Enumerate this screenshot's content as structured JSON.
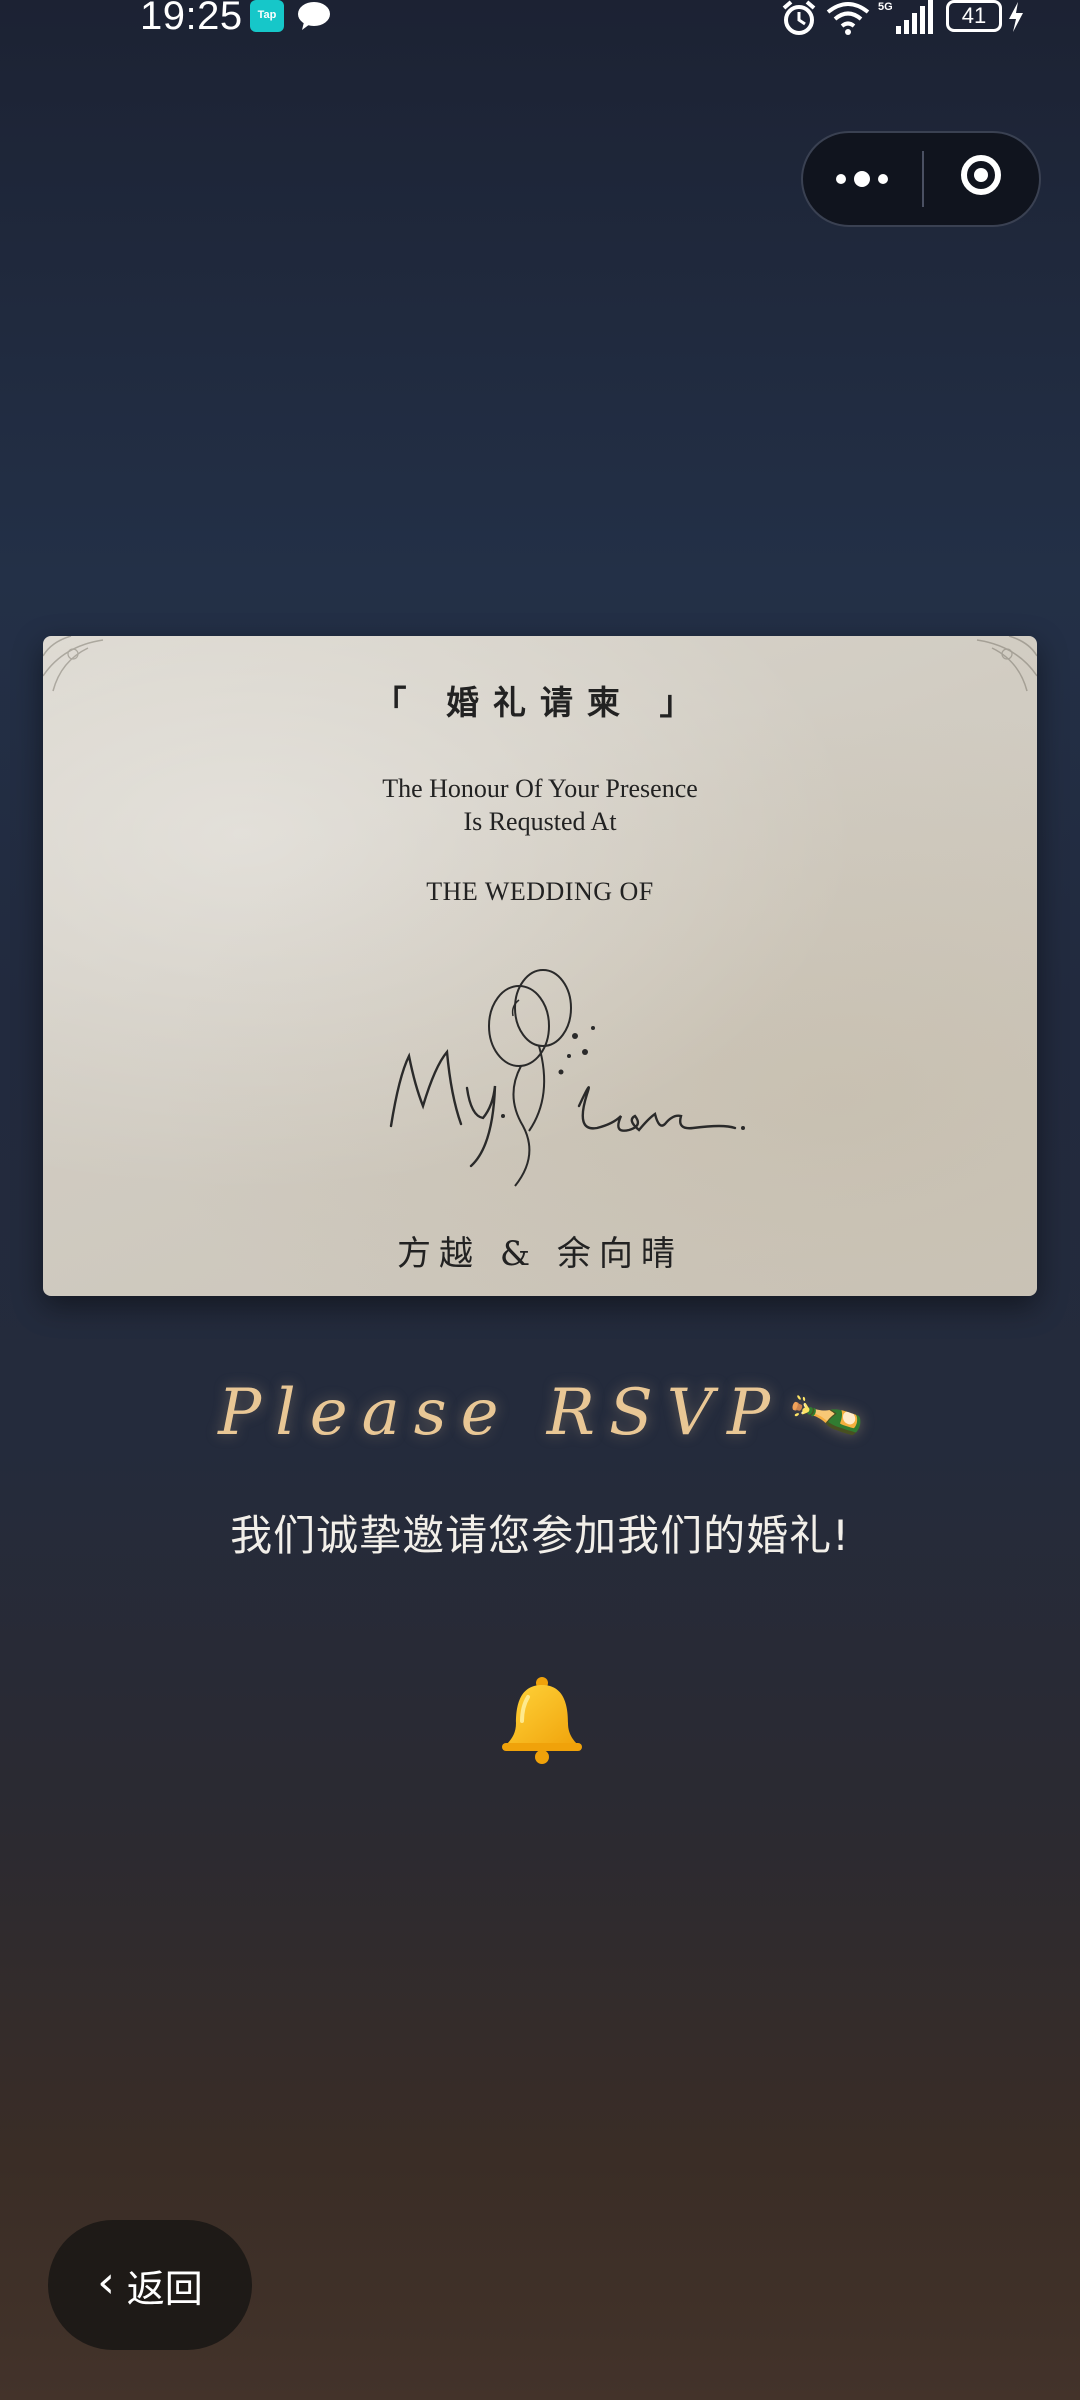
{
  "status_bar": {
    "time": "19:25",
    "app_badge": "Tap",
    "battery": "41"
  },
  "invitation": {
    "title": "「 婚礼请柬 」",
    "line1": "The Honour Of Your Presence",
    "line2": "Is Requsted At",
    "line3": "THE WEDDING OF",
    "script_text": "My Love",
    "names": "方越 & 余向晴"
  },
  "rsvp": {
    "heading": "Please RSVP",
    "emoji": "🍾",
    "subtitle": "我们诚挚邀请您参加我们的婚礼!"
  },
  "back_button": {
    "label": "返回",
    "chevron": "‹"
  },
  "colors": {
    "rsvp_gold": "#e9c795",
    "card_paper": "#d4cfc5",
    "bell_yellow": "#f5b80f"
  }
}
